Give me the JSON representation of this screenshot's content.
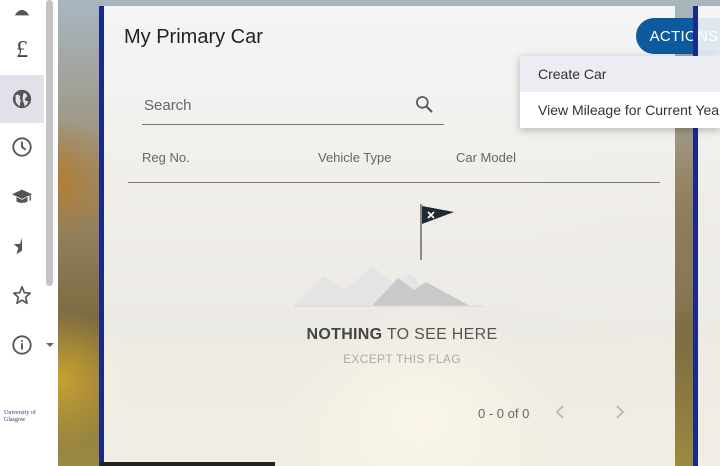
{
  "panel": {
    "title": "My Primary Car",
    "actions_label": "ACTIONS",
    "search": {
      "placeholder": "Search",
      "value": ""
    },
    "columns": [
      "Reg No.",
      "Vehicle Type",
      "Car Model"
    ],
    "empty": {
      "strong": "NOTHING",
      "rest": " TO SEE HERE",
      "sub": "EXCEPT THIS FLAG"
    },
    "pagination": {
      "range": "0 - 0 of 0"
    }
  },
  "menu": {
    "items": [
      "Create Car",
      "View Mileage for Current Year"
    ]
  },
  "sidebar": {
    "icons": [
      "top-icon",
      "pound-icon",
      "globe-icon",
      "clock-icon",
      "graduation-cap-icon",
      "star-half-icon",
      "star-icon",
      "info-icon",
      "chevron-down-icon"
    ],
    "pound_glyph": "£",
    "logo_text": "University of Glasgow"
  },
  "colors": {
    "accent": "#0e5a9e",
    "panel_border": "#1a2a8c"
  }
}
